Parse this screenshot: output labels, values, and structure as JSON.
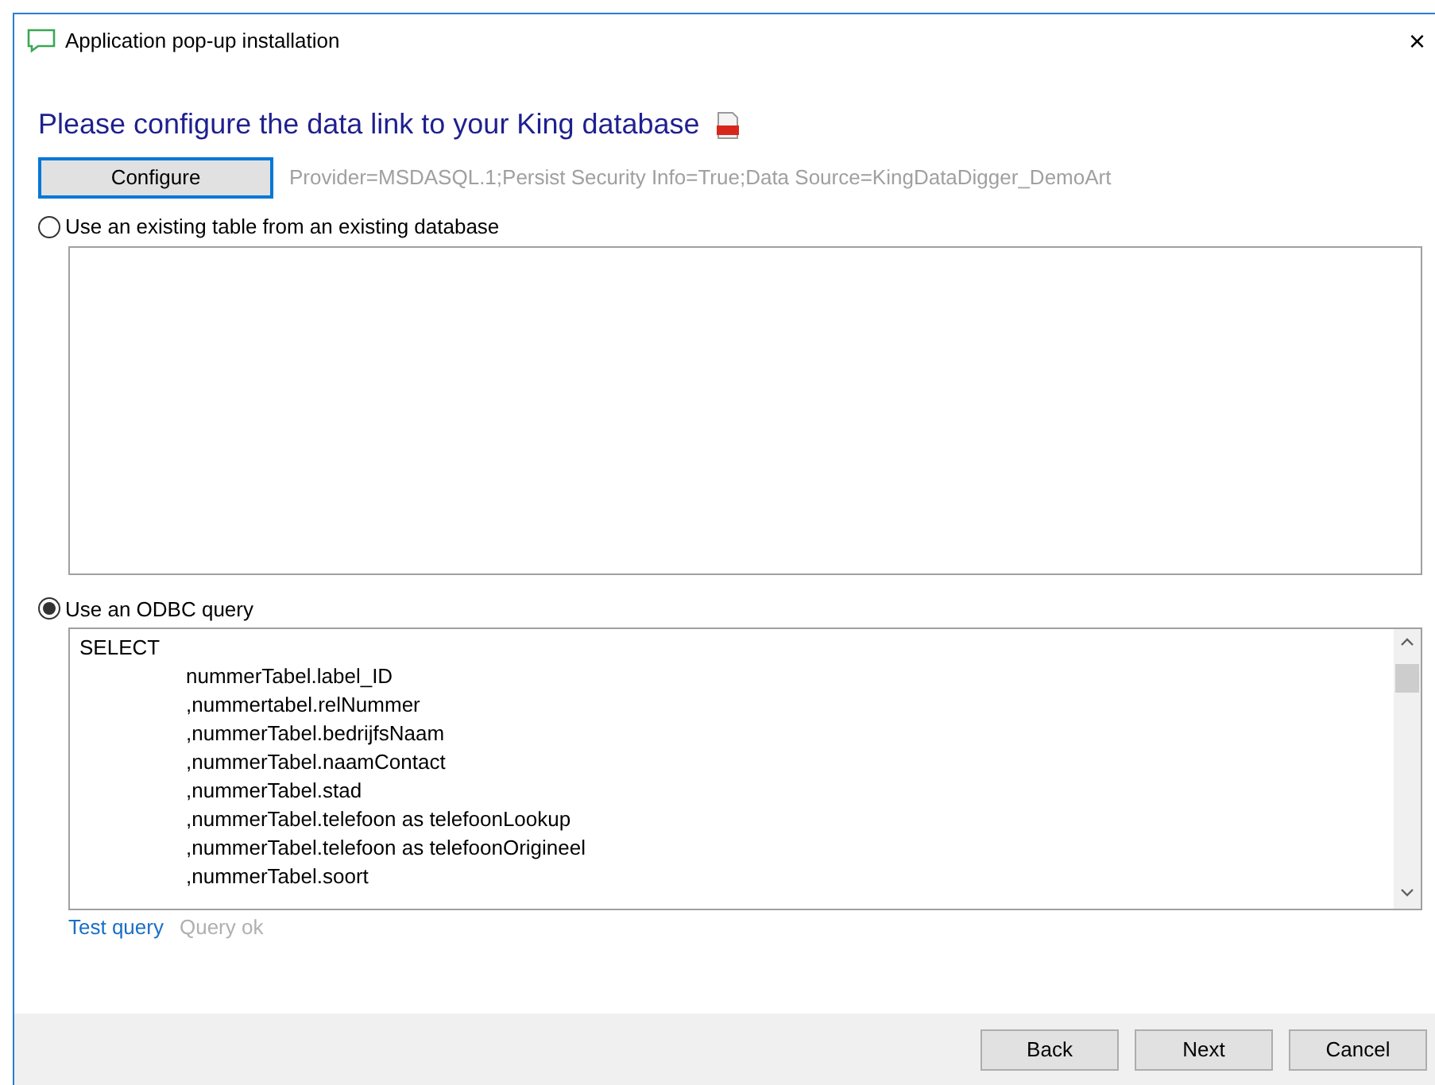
{
  "window": {
    "title": "Application pop-up installation",
    "close": "×"
  },
  "heading": "Please configure the data link to your King database",
  "configure_button": "Configure",
  "connection_string": "Provider=MSDASQL.1;Persist Security Info=True;Data Source=KingDataDigger_DemoArt",
  "options": [
    {
      "label": "Use an existing table from an existing database",
      "selected": false
    },
    {
      "label": "Use an ODBC query",
      "selected": true
    }
  ],
  "query_lines": [
    {
      "kind": "keyword",
      "text": "SELECT"
    },
    {
      "kind": "column",
      "text": "nummerTabel.label_ID"
    },
    {
      "kind": "column",
      "text": ",nummertabel.relNummer"
    },
    {
      "kind": "column",
      "text": ",nummerTabel.bedrijfsNaam"
    },
    {
      "kind": "column",
      "text": ",nummerTabel.naamContact"
    },
    {
      "kind": "column",
      "text": ",nummerTabel.stad"
    },
    {
      "kind": "column",
      "text": ",nummerTabel.telefoon as telefoonLookup"
    },
    {
      "kind": "column",
      "text": ",nummerTabel.telefoon as telefoonOrigineel"
    },
    {
      "kind": "column",
      "text": ",nummerTabel.soort"
    }
  ],
  "test_query_link": "Test query",
  "query_status": "Query ok",
  "buttons": [
    "Back",
    "Next",
    "Cancel"
  ]
}
